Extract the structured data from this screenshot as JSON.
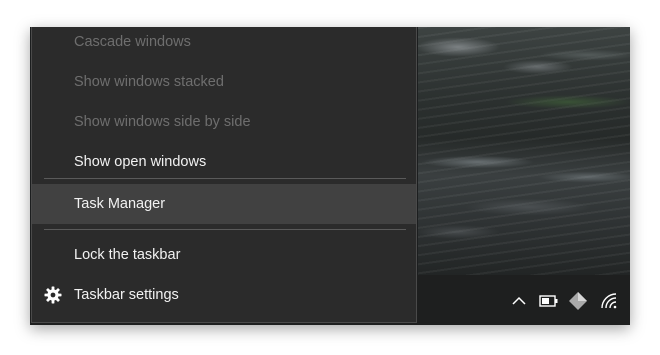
{
  "context_menu": {
    "items": [
      {
        "label": "Cascade windows",
        "enabled": false
      },
      {
        "label": "Show windows stacked",
        "enabled": false
      },
      {
        "label": "Show windows side by side",
        "enabled": false
      },
      {
        "label": "Show open windows",
        "enabled": true
      },
      {
        "label": "Task Manager",
        "enabled": true,
        "highlighted": true
      },
      {
        "label": "Lock the taskbar",
        "enabled": true
      },
      {
        "label": "Taskbar settings",
        "enabled": true,
        "icon": "gear-icon"
      }
    ]
  },
  "tray": {
    "icons": [
      "chevron-up-icon",
      "battery-icon",
      "diamond-app-icon",
      "wifi-icon"
    ]
  },
  "colors": {
    "menu_background": "#2b2b2b",
    "menu_highlight": "#414141",
    "menu_text": "#f2f2f2",
    "menu_text_disabled": "#6e6e6e",
    "taskbar": "#1e1f1f"
  }
}
